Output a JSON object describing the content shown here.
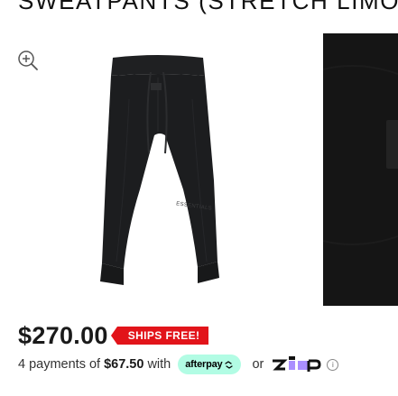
{
  "product": {
    "title": "SWEATPANTS (STRETCH LIMO)",
    "price": "$270.00",
    "shipping_badge": "SHIPS FREE!",
    "brand_print": "ESSENTIALS"
  },
  "payment": {
    "prefix": "4 payments of",
    "installment": "$67.50",
    "with": "with",
    "afterpay_label": "afterpay",
    "or": "or",
    "zip_label": "zip",
    "info_symbol": "i"
  },
  "icons": {
    "zoom": "zoom-in-icon",
    "info": "info-icon"
  },
  "colors": {
    "badge": "#e2141a",
    "afterpay": "#b2fce4",
    "zip_purple": "#aa8fff",
    "product": "#1c1d1f"
  }
}
